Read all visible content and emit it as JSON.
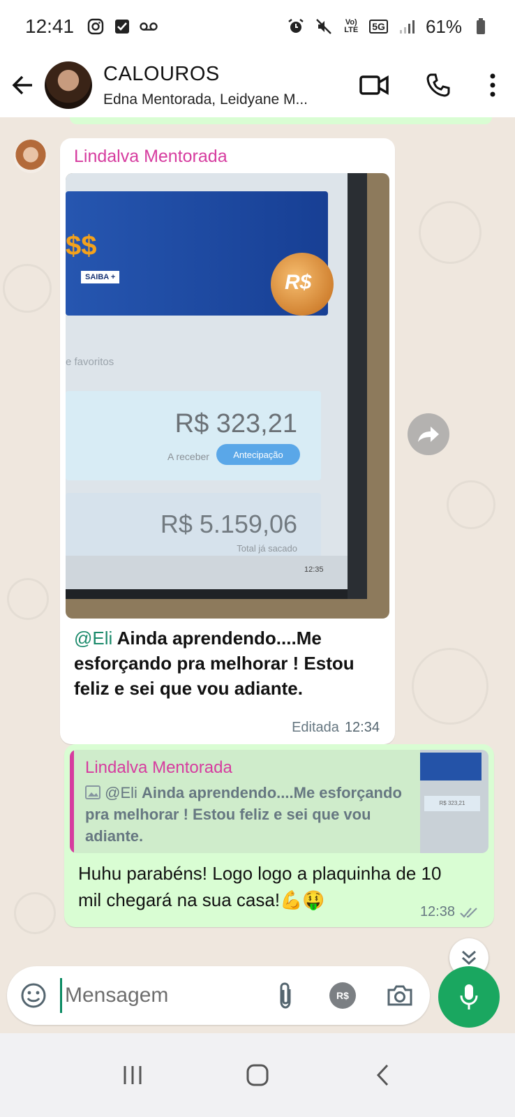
{
  "status_bar": {
    "time": "12:41",
    "network_label": "Vo) LTE",
    "signal_label": "5G",
    "battery": "61%"
  },
  "header": {
    "title": "CALOUROS",
    "subtitle": "Edna Mentorada, Leidyane M..."
  },
  "messages": [
    {
      "sender": "Lindalva Mentorada",
      "image": {
        "banner_text": "$$",
        "banner_button": "SAIBA +",
        "coin_text": "R$",
        "favorites_label": "e favoritos",
        "amount_primary": "R$ 323,21",
        "receive_label": "A receber",
        "antecipation_label": "Antecipação",
        "amount_secondary": "R$ 5.159,06",
        "total_label": "Total já sacado",
        "clock": "12:35"
      },
      "mention": "@Eli",
      "text": "Ainda aprendendo....Me esforçando pra melhorar ! Estou feliz e sei que vou adiante.",
      "edited_label": "Editada",
      "time": "12:34"
    },
    {
      "quote": {
        "sender": "Lindalva Mentorada",
        "mention": "@Eli",
        "text": "Ainda aprendendo....Me esforçando pra melhorar ! Estou feliz e sei que vou adiante.",
        "thumb_amount": "R$ 323,21"
      },
      "text": "Huhu parabéns! Logo logo a plaquinha de 10 mil chegará na sua casa!💪🤑",
      "time": "12:38"
    }
  ],
  "composer": {
    "placeholder": "Mensagem",
    "payment_label": "R$"
  },
  "colors": {
    "accent_green": "#1aa760",
    "sender_pink": "#d63c9f",
    "outgoing_bubble": "#d9fdd3",
    "chat_background": "#efe7de"
  }
}
